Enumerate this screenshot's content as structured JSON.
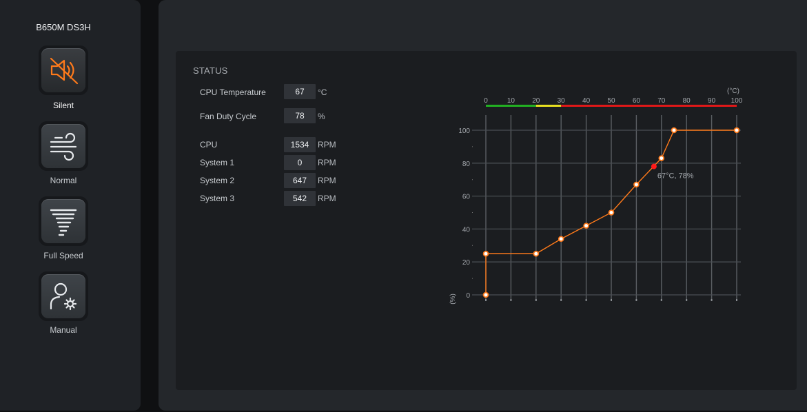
{
  "sidebar": {
    "board_name": "B650M DS3H",
    "modes": [
      {
        "label": "Silent",
        "icon": "speaker-mute-icon",
        "active": true
      },
      {
        "label": "Normal",
        "icon": "wind-icon",
        "active": false
      },
      {
        "label": "Full Speed",
        "icon": "tornado-icon",
        "active": false
      },
      {
        "label": "Manual",
        "icon": "user-gear-icon",
        "active": false
      }
    ]
  },
  "status": {
    "title": "STATUS",
    "cpu_temperature": {
      "label": "CPU Temperature",
      "value": "67",
      "unit": "°C"
    },
    "fan_duty_cycle": {
      "label": "Fan Duty Cycle",
      "value": "78",
      "unit": "%"
    },
    "fans": [
      {
        "label": "CPU",
        "value": "1534",
        "unit": "RPM"
      },
      {
        "label": "System 1",
        "value": "0",
        "unit": "RPM"
      },
      {
        "label": "System 2",
        "value": "647",
        "unit": "RPM"
      },
      {
        "label": "System 3",
        "value": "542",
        "unit": "RPM"
      }
    ]
  },
  "colors": {
    "accent": "#ff7a1a",
    "current_point": "#ff1a1a",
    "scale_green": "#22b022",
    "scale_yellow": "#e8e020",
    "scale_red": "#e01818"
  },
  "chart_data": {
    "type": "line",
    "x_unit_label": "(°C)",
    "y_unit_label": "(%)",
    "xlim": [
      0,
      100
    ],
    "ylim": [
      0,
      100
    ],
    "x_ticks": [
      0,
      10,
      20,
      30,
      40,
      50,
      60,
      70,
      80,
      90,
      100
    ],
    "y_ticks": [
      0,
      20,
      40,
      60,
      80,
      100
    ],
    "grid": true,
    "temperature_scale": [
      {
        "from": 0,
        "to": 20,
        "color": "green"
      },
      {
        "from": 20,
        "to": 30,
        "color": "yellow"
      },
      {
        "from": 30,
        "to": 100,
        "color": "red"
      }
    ],
    "series": [
      {
        "x": [
          0,
          0,
          20,
          30,
          40,
          50,
          60,
          70,
          75,
          100
        ],
        "y": [
          0,
          25,
          25,
          34,
          42,
          50,
          67,
          83,
          100,
          100
        ]
      }
    ],
    "current": {
      "x": 67,
      "y": 78,
      "label": "67°C, 78%"
    }
  }
}
